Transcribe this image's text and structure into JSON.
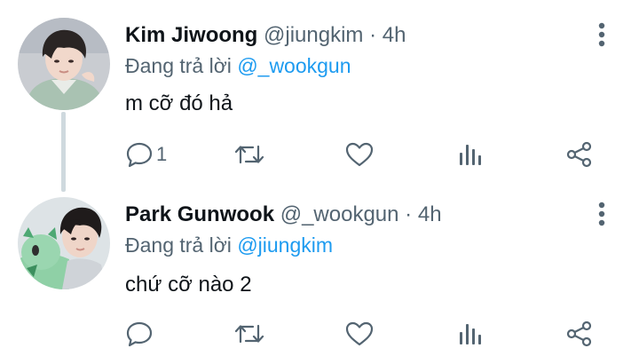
{
  "tweets": [
    {
      "display_name": "Kim Jiwoong",
      "handle": "@jiungkim",
      "separator": "·",
      "time": "4h",
      "replying_prefix": "Đang trả lời",
      "replying_to": "@_wookgun",
      "text": "m cỡ đó hả",
      "reply_count": "1",
      "avatar_icon": "user-photo-avatar"
    },
    {
      "display_name": "Park Gunwook",
      "handle": "@_wookgun",
      "separator": "·",
      "time": "4h",
      "replying_prefix": "Đang trả lời",
      "replying_to": "@jiungkim",
      "text": "chứ cỡ nào 2",
      "reply_count": "",
      "avatar_icon": "user-photo-avatar"
    }
  ],
  "icons": [
    "reply-icon",
    "retweet-icon",
    "like-icon",
    "views-icon",
    "share-icon",
    "more-icon"
  ],
  "colors": {
    "text": "#0f1419",
    "secondary": "#536471",
    "accent": "#1d9bf0",
    "thread_line": "#cfd9de"
  }
}
